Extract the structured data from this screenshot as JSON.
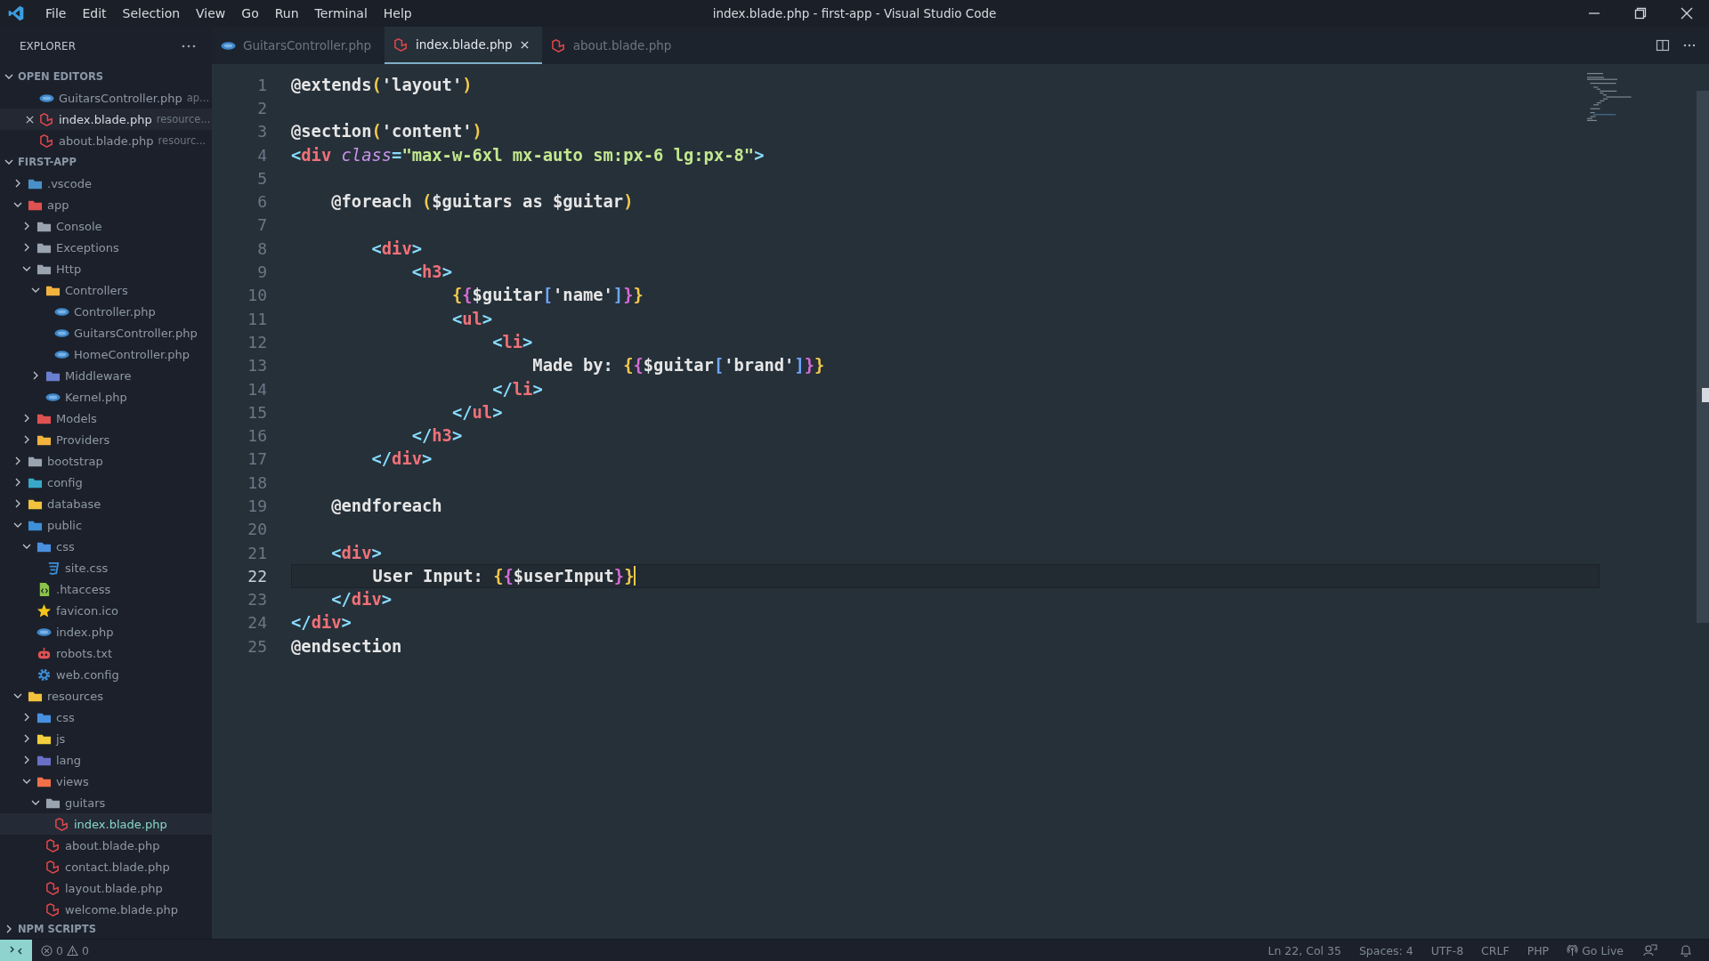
{
  "window": {
    "title": "index.blade.php - first-app - Visual Studio Code"
  },
  "menu": [
    "File",
    "Edit",
    "Selection",
    "View",
    "Go",
    "Run",
    "Terminal",
    "Help"
  ],
  "sidebar": {
    "title": "EXPLORER",
    "open_editors": {
      "label": "OPEN EDITORS",
      "expanded": true,
      "items": [
        {
          "name": "GuitarsController.php",
          "path": "ap...",
          "kind": "php",
          "selected": false
        },
        {
          "name": "index.blade.php",
          "path": "resource...",
          "kind": "blade",
          "selected": true
        },
        {
          "name": "about.blade.php",
          "path": "resourc...",
          "kind": "blade",
          "selected": false
        }
      ]
    },
    "project": {
      "label": "FIRST-APP",
      "expanded": true,
      "tree": [
        {
          "name": ".vscode",
          "kind": "folder",
          "color": "#4a90c8",
          "expanded": false,
          "selected": false
        },
        {
          "name": "app",
          "kind": "folder",
          "color": "#e05252",
          "expanded": true,
          "selected": false,
          "children": [
            {
              "name": "Console",
              "kind": "folder",
              "color": "#9aa4b0",
              "expanded": false,
              "selected": false
            },
            {
              "name": "Exceptions",
              "kind": "folder",
              "color": "#9aa4b0",
              "expanded": false,
              "selected": false
            },
            {
              "name": "Http",
              "kind": "folder",
              "color": "#9aa4b0",
              "expanded": true,
              "selected": false,
              "children": [
                {
                  "name": "Controllers",
                  "kind": "folder",
                  "color": "#f2b33d",
                  "expanded": true,
                  "selected": false,
                  "children": [
                    {
                      "name": "Controller.php",
                      "kind": "php",
                      "selected": false
                    },
                    {
                      "name": "GuitarsController.php",
                      "kind": "php",
                      "selected": false
                    },
                    {
                      "name": "HomeController.php",
                      "kind": "php",
                      "selected": false
                    }
                  ]
                },
                {
                  "name": "Middleware",
                  "kind": "folder",
                  "color": "#6a7fd0",
                  "expanded": false,
                  "selected": false
                },
                {
                  "name": "Kernel.php",
                  "kind": "php",
                  "selected": false
                }
              ]
            },
            {
              "name": "Models",
              "kind": "folder",
              "color": "#e05252",
              "expanded": false,
              "selected": false
            },
            {
              "name": "Providers",
              "kind": "folder",
              "color": "#f2b33d",
              "expanded": false,
              "selected": false
            }
          ]
        },
        {
          "name": "bootstrap",
          "kind": "folder",
          "color": "#9aa4b0",
          "expanded": false,
          "selected": false
        },
        {
          "name": "config",
          "kind": "folder",
          "color": "#38a8c8",
          "expanded": false,
          "selected": false
        },
        {
          "name": "database",
          "kind": "folder",
          "color": "#f2c23d",
          "expanded": false,
          "selected": false
        },
        {
          "name": "public",
          "kind": "folder",
          "color": "#3d8fd8",
          "expanded": true,
          "selected": false,
          "children": [
            {
              "name": "css",
              "kind": "folder",
              "color": "#4a90e0",
              "expanded": true,
              "selected": false,
              "children": [
                {
                  "name": "site.css",
                  "kind": "css",
                  "selected": false
                }
              ]
            },
            {
              "name": ".htaccess",
              "kind": "htaccess",
              "selected": false
            },
            {
              "name": "favicon.ico",
              "kind": "favicon",
              "selected": false
            },
            {
              "name": "index.php",
              "kind": "php",
              "selected": false
            },
            {
              "name": "robots.txt",
              "kind": "robots",
              "selected": false
            },
            {
              "name": "web.config",
              "kind": "config",
              "selected": false
            }
          ]
        },
        {
          "name": "resources",
          "kind": "folder",
          "color": "#f2c23d",
          "expanded": true,
          "selected": false,
          "children": [
            {
              "name": "css",
              "kind": "folder",
              "color": "#4a90e0",
              "expanded": false,
              "selected": false
            },
            {
              "name": "js",
              "kind": "folder",
              "color": "#f2d03d",
              "expanded": false,
              "selected": false
            },
            {
              "name": "lang",
              "kind": "folder",
              "color": "#6a6fc8",
              "expanded": false,
              "selected": false
            },
            {
              "name": "views",
              "kind": "folder",
              "color": "#f0704a",
              "expanded": true,
              "selected": false,
              "children": [
                {
                  "name": "guitars",
                  "kind": "folder",
                  "color": "#9aa4b0",
                  "expanded": true,
                  "selected": false,
                  "children": [
                    {
                      "name": "index.blade.php",
                      "kind": "blade",
                      "selected": true
                    }
                  ]
                },
                {
                  "name": "about.blade.php",
                  "kind": "blade",
                  "selected": false
                },
                {
                  "name": "contact.blade.php",
                  "kind": "blade",
                  "selected": false
                },
                {
                  "name": "layout.blade.php",
                  "kind": "blade",
                  "selected": false
                },
                {
                  "name": "welcome.blade.php",
                  "kind": "blade",
                  "selected": false
                }
              ]
            }
          ]
        }
      ]
    },
    "npm_scripts": {
      "label": "NPM SCRIPTS",
      "expanded": false
    }
  },
  "tabs": [
    {
      "label": "GuitarsController.php",
      "kind": "php",
      "selected": false
    },
    {
      "label": "index.blade.php",
      "kind": "blade",
      "selected": true
    },
    {
      "label": "about.blade.php",
      "kind": "blade",
      "selected": false
    }
  ],
  "editor": {
    "lines": [
      {
        "number": "1",
        "current": false,
        "tokens": [
          {
            "text": "@extends",
            "kind": "dir"
          },
          {
            "text": "(",
            "kind": "paren"
          },
          {
            "text": "'layout'",
            "kind": "str"
          },
          {
            "text": ")",
            "kind": "paren"
          }
        ]
      },
      {
        "number": "2",
        "current": false
      },
      {
        "number": "3",
        "current": false,
        "tokens": [
          {
            "text": "@section",
            "kind": "dir"
          },
          {
            "text": "(",
            "kind": "paren"
          },
          {
            "text": "'content'",
            "kind": "str"
          },
          {
            "text": ")",
            "kind": "paren"
          }
        ]
      },
      {
        "number": "4",
        "current": false,
        "tokens": [
          {
            "text": "<",
            "kind": "punct"
          },
          {
            "text": "div",
            "kind": "tag"
          },
          {
            "text": " class",
            "kind": "attr"
          },
          {
            "text": "=",
            "kind": "punct"
          },
          {
            "text": "\"max-w-6xl mx-auto sm:px-6 lg:px-8\"",
            "kind": "attrstr"
          },
          {
            "text": ">",
            "kind": "punct"
          }
        ]
      },
      {
        "number": "5",
        "current": false
      },
      {
        "number": "6",
        "current": false,
        "tokens": [
          {
            "text": "    @foreach ",
            "kind": "dir"
          },
          {
            "text": "(",
            "kind": "paren"
          },
          {
            "text": "$guitars as $guitar",
            "kind": "text"
          },
          {
            "text": ")",
            "kind": "paren"
          }
        ]
      },
      {
        "number": "7",
        "current": false
      },
      {
        "number": "8",
        "current": false,
        "tokens": [
          {
            "text": "        <",
            "kind": "punct"
          },
          {
            "text": "div",
            "kind": "tag"
          },
          {
            "text": ">",
            "kind": "punct"
          }
        ]
      },
      {
        "number": "9",
        "current": false,
        "tokens": [
          {
            "text": "            <",
            "kind": "punct"
          },
          {
            "text": "h3",
            "kind": "tag"
          },
          {
            "text": ">",
            "kind": "punct"
          }
        ]
      },
      {
        "number": "10",
        "current": false,
        "tokens": [
          {
            "text": "                {",
            "kind": "brace1"
          },
          {
            "text": "{",
            "kind": "brace2"
          },
          {
            "text": "$guitar",
            "kind": "text"
          },
          {
            "text": "[",
            "kind": "bracket"
          },
          {
            "text": "'name'",
            "kind": "str"
          },
          {
            "text": "]",
            "kind": "bracket"
          },
          {
            "text": "}",
            "kind": "brace2"
          },
          {
            "text": "}",
            "kind": "brace1"
          }
        ]
      },
      {
        "number": "11",
        "current": false,
        "tokens": [
          {
            "text": "                <",
            "kind": "punct"
          },
          {
            "text": "ul",
            "kind": "tag"
          },
          {
            "text": ">",
            "kind": "punct"
          }
        ]
      },
      {
        "number": "12",
        "current": false,
        "tokens": [
          {
            "text": "                    <",
            "kind": "punct"
          },
          {
            "text": "li",
            "kind": "tag"
          },
          {
            "text": ">",
            "kind": "punct"
          }
        ]
      },
      {
        "number": "13",
        "current": false,
        "tokens": [
          {
            "text": "                        Made by: ",
            "kind": "text"
          },
          {
            "text": "{",
            "kind": "brace1"
          },
          {
            "text": "{",
            "kind": "brace2"
          },
          {
            "text": "$guitar",
            "kind": "text"
          },
          {
            "text": "[",
            "kind": "bracket"
          },
          {
            "text": "'brand'",
            "kind": "str"
          },
          {
            "text": "]",
            "kind": "bracket"
          },
          {
            "text": "}",
            "kind": "brace2"
          },
          {
            "text": "}",
            "kind": "brace1"
          }
        ]
      },
      {
        "number": "14",
        "current": false,
        "tokens": [
          {
            "text": "                    </",
            "kind": "punct"
          },
          {
            "text": "li",
            "kind": "tag"
          },
          {
            "text": ">",
            "kind": "punct"
          }
        ]
      },
      {
        "number": "15",
        "current": false,
        "tokens": [
          {
            "text": "                </",
            "kind": "punct"
          },
          {
            "text": "ul",
            "kind": "tag"
          },
          {
            "text": ">",
            "kind": "punct"
          }
        ]
      },
      {
        "number": "16",
        "current": false,
        "tokens": [
          {
            "text": "            </",
            "kind": "punct"
          },
          {
            "text": "h3",
            "kind": "tag"
          },
          {
            "text": ">",
            "kind": "punct"
          }
        ]
      },
      {
        "number": "17",
        "current": false,
        "tokens": [
          {
            "text": "        </",
            "kind": "punct"
          },
          {
            "text": "div",
            "kind": "tag"
          },
          {
            "text": ">",
            "kind": "punct"
          }
        ]
      },
      {
        "number": "18",
        "current": false
      },
      {
        "number": "19",
        "current": false,
        "tokens": [
          {
            "text": "    @endforeach",
            "kind": "dir"
          }
        ]
      },
      {
        "number": "20",
        "current": false
      },
      {
        "number": "21",
        "current": false,
        "tokens": [
          {
            "text": "    <",
            "kind": "punct"
          },
          {
            "text": "div",
            "kind": "tag"
          },
          {
            "text": ">",
            "kind": "punct"
          }
        ]
      },
      {
        "number": "22",
        "current": true,
        "tokens": [
          {
            "text": "        User Input: ",
            "kind": "text"
          },
          {
            "text": "{",
            "kind": "brace1"
          },
          {
            "text": "{",
            "kind": "brace2"
          },
          {
            "text": "$userInput",
            "kind": "text"
          },
          {
            "text": "}",
            "kind": "brace2"
          },
          {
            "text": "}",
            "kind": "brace1"
          }
        ]
      },
      {
        "number": "23",
        "current": false,
        "tokens": [
          {
            "text": "    </",
            "kind": "punct"
          },
          {
            "text": "div",
            "kind": "tag"
          },
          {
            "text": ">",
            "kind": "punct"
          }
        ]
      },
      {
        "number": "24",
        "current": false,
        "tokens": [
          {
            "text": "</",
            "kind": "punct"
          },
          {
            "text": "div",
            "kind": "tag"
          },
          {
            "text": ">",
            "kind": "punct"
          }
        ]
      },
      {
        "number": "25",
        "current": false,
        "tokens": [
          {
            "text": "@endsection",
            "kind": "dir"
          }
        ]
      }
    ]
  },
  "status_bar": {
    "errors": "0",
    "warnings": "0",
    "items": [
      "Ln 22, Col 35",
      "Spaces: 4",
      "UTF-8",
      "CRLF",
      "PHP"
    ],
    "go_live": "Go Live"
  }
}
